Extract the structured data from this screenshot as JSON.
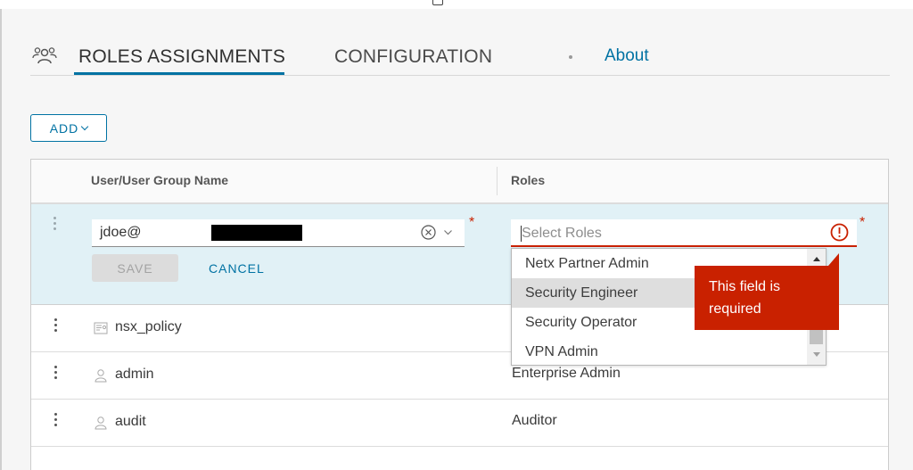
{
  "tabs": {
    "roles_assignments": "ROLES ASSIGNMENTS",
    "configuration": "CONFIGURATION",
    "about": "About",
    "icon": "user-group-icon"
  },
  "toolbar": {
    "add_label": "ADD"
  },
  "table": {
    "columns": [
      "User/User Group Name",
      "Roles"
    ],
    "edit_row": {
      "user_value": "jdoe@",
      "roles_placeholder": "Select Roles",
      "required_marker": "*",
      "save_label": "SAVE",
      "cancel_label": "CANCEL",
      "error_message": "This field is required"
    },
    "rows": [
      {
        "name": "nsx_policy",
        "role": "",
        "icon": "principal-identity-icon"
      },
      {
        "name": "admin",
        "role": "Enterprise Admin",
        "icon": "user-icon"
      },
      {
        "name": "audit",
        "role": "Auditor",
        "icon": "user-icon"
      }
    ]
  },
  "roles_dropdown": {
    "options": [
      "Netx Partner Admin",
      "Security Engineer",
      "Security Operator",
      "VPN Admin"
    ],
    "highlighted": "Security Engineer"
  },
  "colors": {
    "accent": "#0072a3",
    "error": "#c92100",
    "selected_row": "#e1f1f6"
  }
}
